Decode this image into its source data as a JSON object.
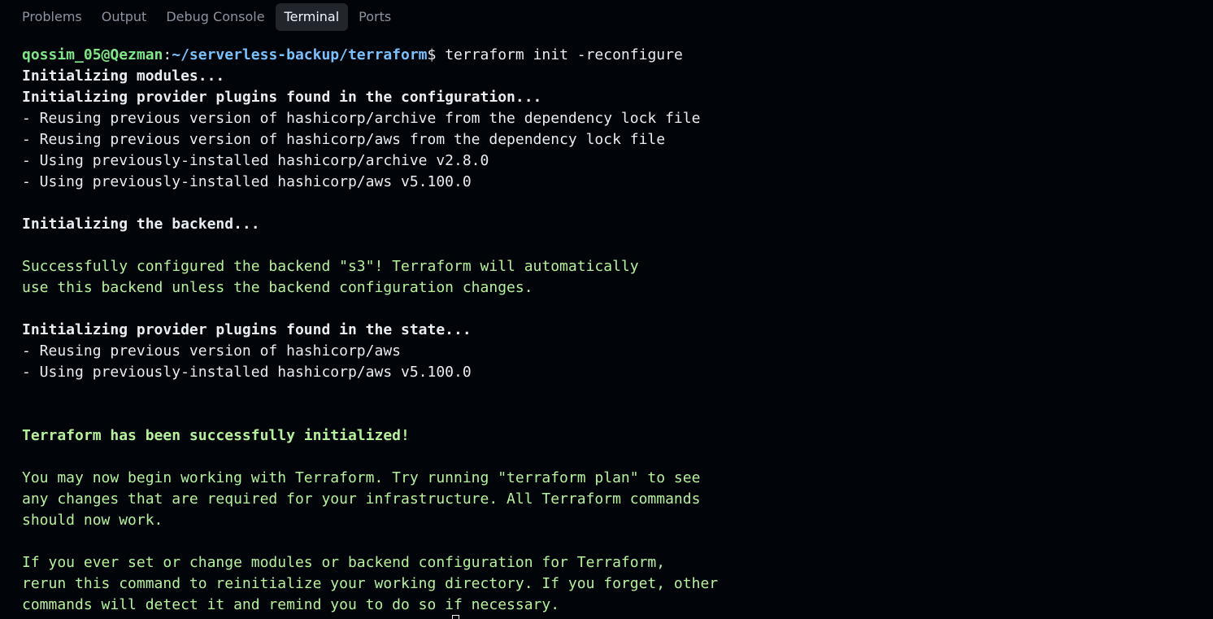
{
  "tabs": [
    {
      "label": "Problems",
      "active": false
    },
    {
      "label": "Output",
      "active": false
    },
    {
      "label": "Debug Console",
      "active": false
    },
    {
      "label": "Terminal",
      "active": true
    },
    {
      "label": "Ports",
      "active": false
    }
  ],
  "prompt": {
    "user_host": "qossim_05@Qezman",
    "separator": ":",
    "path": "~/serverless-backup/terraform",
    "symbol": "$",
    "command": " terraform init -reconfigure"
  },
  "output_lines": [
    {
      "text": "Initializing modules...",
      "style": "bold"
    },
    {
      "text": "Initializing provider plugins found in the configuration...",
      "style": "bold"
    },
    {
      "text": "- Reusing previous version of hashicorp/archive from the dependency lock file",
      "style": "white"
    },
    {
      "text": "- Reusing previous version of hashicorp/aws from the dependency lock file",
      "style": "white"
    },
    {
      "text": "- Using previously-installed hashicorp/archive v2.8.0",
      "style": "white"
    },
    {
      "text": "- Using previously-installed hashicorp/aws v5.100.0",
      "style": "white"
    },
    {
      "text": "",
      "style": "white"
    },
    {
      "text": "Initializing the backend...",
      "style": "bold"
    },
    {
      "text": "",
      "style": "white"
    },
    {
      "text": "Successfully configured the backend \"s3\"! Terraform will automatically",
      "style": "green"
    },
    {
      "text": "use this backend unless the backend configuration changes.",
      "style": "green"
    },
    {
      "text": "",
      "style": "white"
    },
    {
      "text": "Initializing provider plugins found in the state...",
      "style": "bold"
    },
    {
      "text": "- Reusing previous version of hashicorp/aws",
      "style": "white"
    },
    {
      "text": "- Using previously-installed hashicorp/aws v5.100.0",
      "style": "white"
    },
    {
      "text": "",
      "style": "white"
    },
    {
      "text": "",
      "style": "white"
    },
    {
      "text": "Terraform has been successfully initialized!",
      "style": "green-bold"
    },
    {
      "text": "",
      "style": "white"
    },
    {
      "text": "You may now begin working with Terraform. Try running \"terraform plan\" to see",
      "style": "green"
    },
    {
      "text": "any changes that are required for your infrastructure. All Terraform commands",
      "style": "green"
    },
    {
      "text": "should now work.",
      "style": "green"
    },
    {
      "text": "",
      "style": "white"
    },
    {
      "text": "If you ever set or change modules or backend configuration for Terraform,",
      "style": "green"
    },
    {
      "text": "rerun this command to reinitialize your working directory. If you forget, other",
      "style": "green"
    },
    {
      "text": "commands will detect it and remind you to do so if necessary.",
      "style": "green"
    }
  ]
}
